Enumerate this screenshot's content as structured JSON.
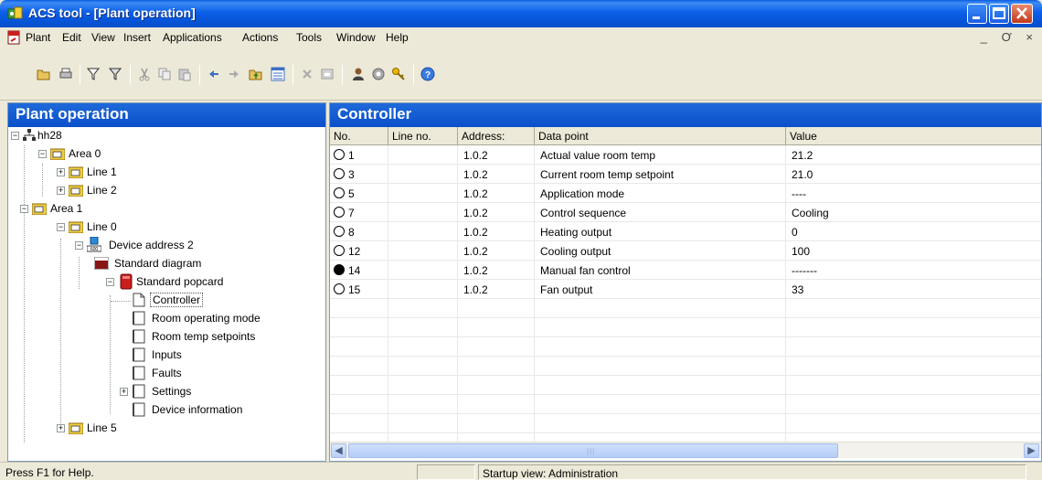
{
  "window": {
    "title": "ACS tool - [Plant operation]"
  },
  "menu": {
    "items": [
      "Plant",
      "Edit",
      "View",
      "Insert",
      "Applications",
      "Actions",
      "Tools",
      "Window",
      "Help"
    ],
    "mdi_controls": "_ Ơ ×"
  },
  "toolbar": {
    "buttons": [
      "open-icon",
      "print-icon",
      "filter-icon",
      "filter-active-icon",
      "cut-icon",
      "copy-icon",
      "paste-icon",
      "back-icon",
      "forward-icon",
      "folder-up-icon",
      "list-view-icon",
      "delete-icon",
      "properties-icon",
      "user-icon",
      "settings-icon",
      "key-icon",
      "help-icon"
    ]
  },
  "left_pane": {
    "header": "Plant operation",
    "tree": {
      "root": "hh28",
      "area0": "Area 0",
      "line1": "Line 1",
      "line2": "Line 2",
      "area1": "Area 1",
      "line0": "Line 0",
      "device": "Device address 2",
      "standard_diagram": "Standard diagram",
      "standard_popcard": "Standard popcard",
      "controller": "Controller",
      "room_operating_mode": "Room operating mode",
      "room_temp_setpoints": "Room temp setpoints",
      "inputs": "Inputs",
      "faults": "Faults",
      "settings": "Settings",
      "device_information": "Device information",
      "line5": "Line 5"
    }
  },
  "right_pane": {
    "header": "Controller",
    "columns": [
      "No.",
      "Line no.",
      "Address:",
      "Data point",
      "Value"
    ],
    "rows": [
      {
        "no": "1",
        "line_no": "",
        "address": "1.0.2",
        "data_point": "Actual value room temp",
        "value": "21.2",
        "filled": false
      },
      {
        "no": "3",
        "line_no": "",
        "address": "1.0.2",
        "data_point": "Current room temp setpoint",
        "value": "21.0",
        "filled": false
      },
      {
        "no": "5",
        "line_no": "",
        "address": "1.0.2",
        "data_point": "Application mode",
        "value": "----",
        "filled": false
      },
      {
        "no": "7",
        "line_no": "",
        "address": "1.0.2",
        "data_point": "Control sequence",
        "value": "Cooling",
        "filled": false
      },
      {
        "no": "8",
        "line_no": "",
        "address": "1.0.2",
        "data_point": "Heating output",
        "value": "0",
        "filled": false
      },
      {
        "no": "12",
        "line_no": "",
        "address": "1.0.2",
        "data_point": "Cooling output",
        "value": "100",
        "filled": false
      },
      {
        "no": "14",
        "line_no": "",
        "address": "1.0.2",
        "data_point": "Manual fan control",
        "value": "-------",
        "filled": true
      },
      {
        "no": "15",
        "line_no": "",
        "address": "1.0.2",
        "data_point": "Fan output",
        "value": "33",
        "filled": false
      }
    ]
  },
  "statusbar": {
    "help": "Press F1 for Help.",
    "empty": "",
    "view": "Startup view: Administration"
  }
}
